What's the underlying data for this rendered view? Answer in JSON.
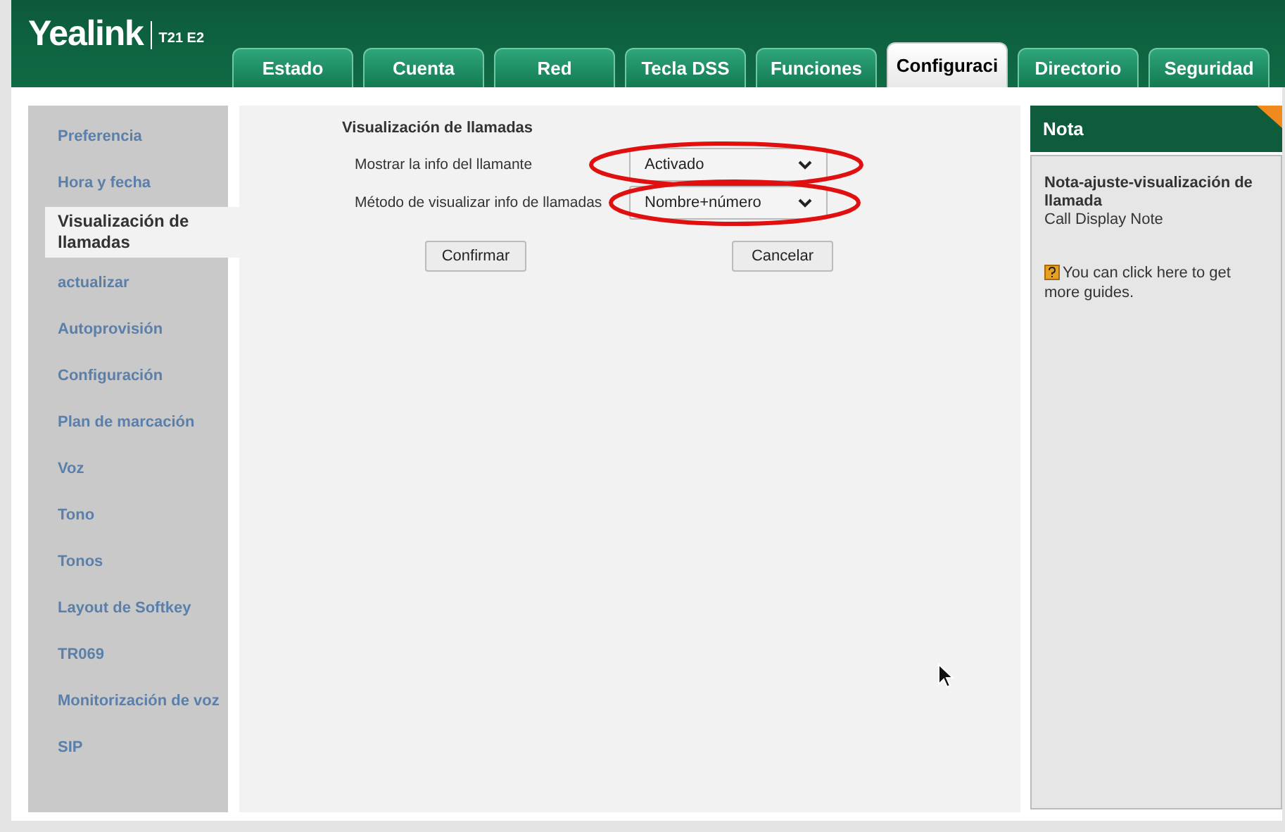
{
  "logo": {
    "brand": "Yealink",
    "model": "T21 E2"
  },
  "tabs": [
    {
      "label": "Estado",
      "selected": false
    },
    {
      "label": "Cuenta",
      "selected": false
    },
    {
      "label": "Red",
      "selected": false
    },
    {
      "label": "Tecla DSS",
      "selected": false
    },
    {
      "label": "Funciones",
      "selected": false
    },
    {
      "label": "Configuraci",
      "selected": true
    },
    {
      "label": "Directorio",
      "selected": false
    },
    {
      "label": "Seguridad",
      "selected": false
    }
  ],
  "sidebar": {
    "items": [
      {
        "label": "Preferencia",
        "selected": false
      },
      {
        "label": "Hora y fecha",
        "selected": false
      },
      {
        "label": "Visualización de llamadas",
        "selected": true
      },
      {
        "label": "actualizar",
        "selected": false
      },
      {
        "label": "Autoprovisión",
        "selected": false
      },
      {
        "label": "Configuración",
        "selected": false
      },
      {
        "label": "Plan de marcación",
        "selected": false
      },
      {
        "label": "Voz",
        "selected": false
      },
      {
        "label": "Tono",
        "selected": false
      },
      {
        "label": "Tonos",
        "selected": false
      },
      {
        "label": "Layout de Softkey",
        "selected": false
      },
      {
        "label": "TR069",
        "selected": false
      },
      {
        "label": "Monitorización de voz",
        "selected": false
      },
      {
        "label": "SIP",
        "selected": false
      }
    ]
  },
  "form": {
    "title": "Visualización de llamadas",
    "fields": [
      {
        "label": "Mostrar la info del llamante",
        "value": "Activado",
        "highlighted": true
      },
      {
        "label": "Método de visualizar info de llamadas",
        "value": "Nombre+número",
        "highlighted": true
      }
    ],
    "buttons": [
      "Confirmar",
      "Cancelar"
    ]
  },
  "note": {
    "title": "Nota",
    "heading": "Nota-ajuste-visualización de llamada",
    "subtitle": "Call Display Note",
    "guide": "You can click here to get more guides."
  }
}
